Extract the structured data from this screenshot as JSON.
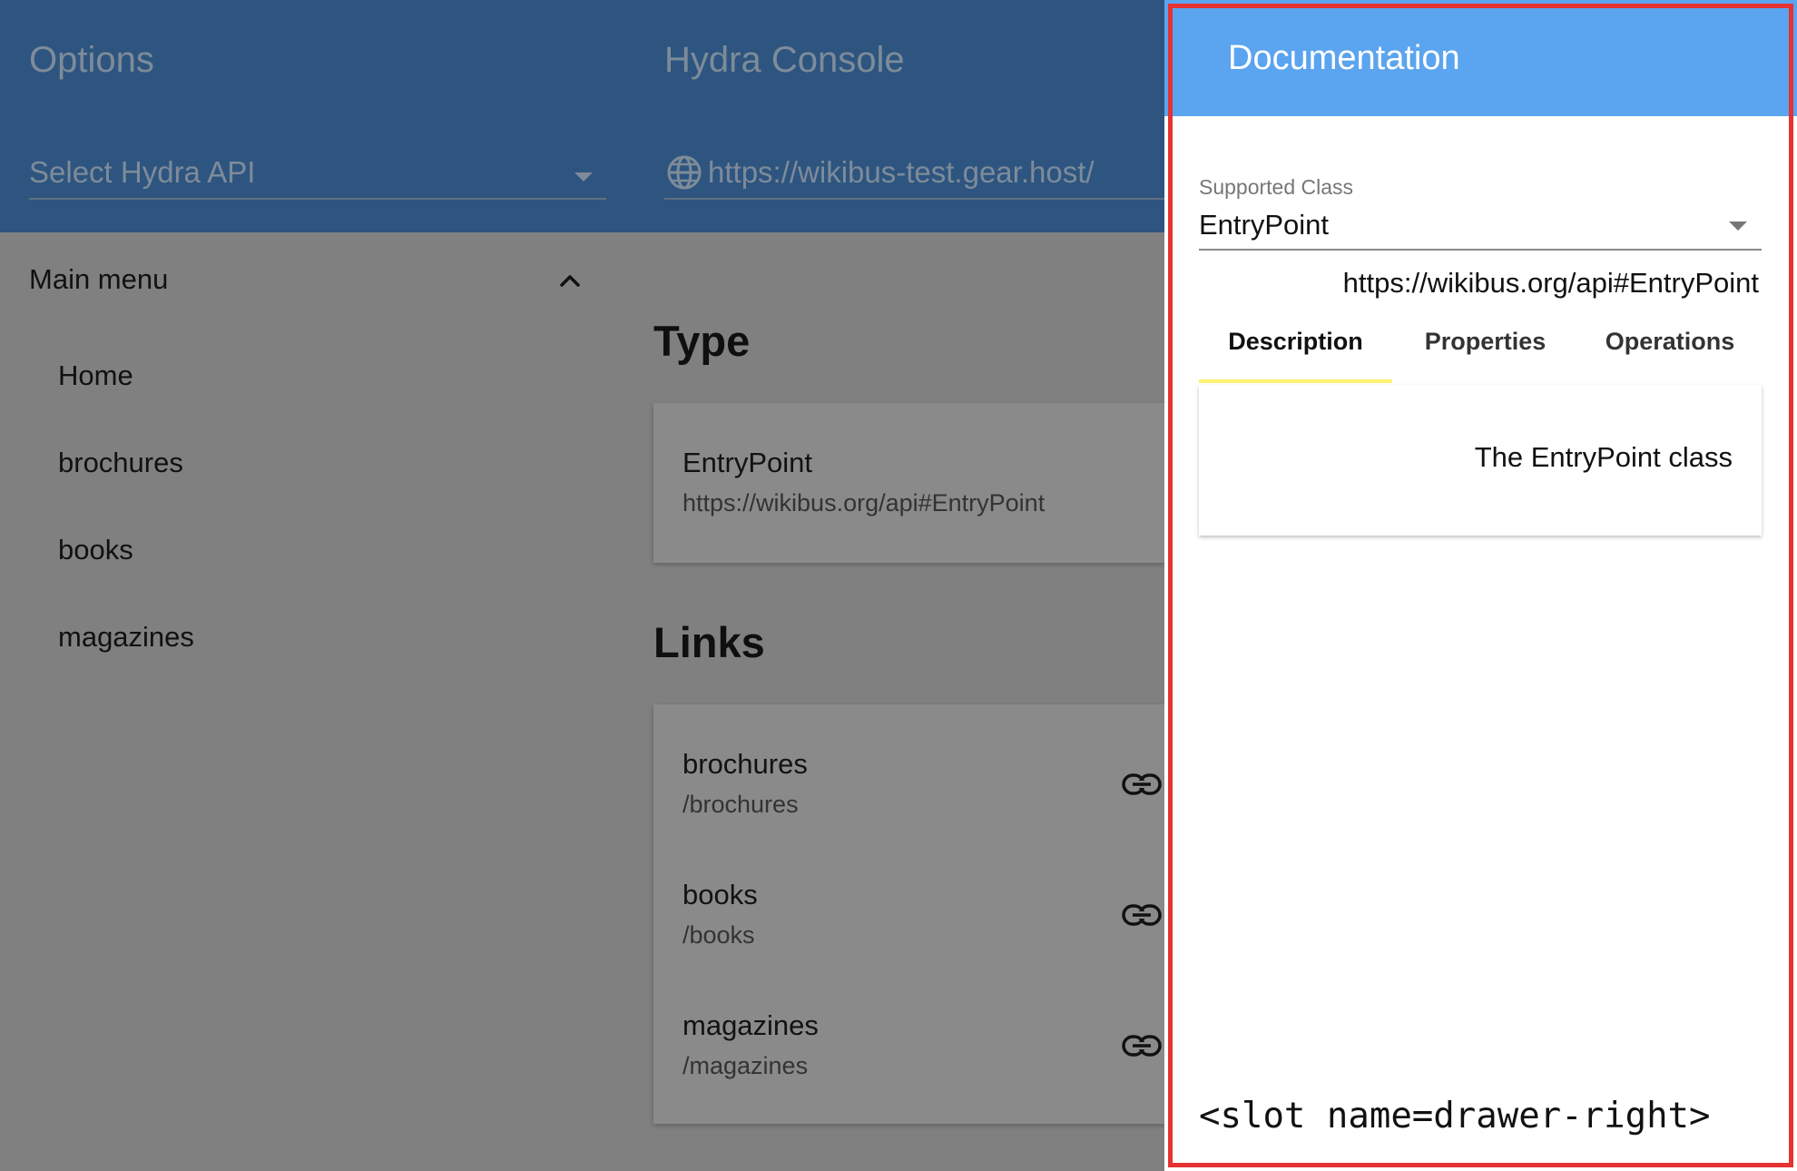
{
  "left_header": {
    "title": "Options",
    "api_select_placeholder": "Select Hydra API"
  },
  "center_header": {
    "title": "Hydra Console",
    "url": "https://wikibus-test.gear.host/"
  },
  "sidebar": {
    "header": "Main menu",
    "items": [
      {
        "label": "Home"
      },
      {
        "label": "brochures"
      },
      {
        "label": "books"
      },
      {
        "label": "magazines"
      }
    ]
  },
  "main": {
    "type_heading": "Type",
    "type_card": {
      "title": "EntryPoint",
      "iri": "https://wikibus.org/api#EntryPoint"
    },
    "links_heading": "Links",
    "links": [
      {
        "title": "brochures",
        "path": "/brochures"
      },
      {
        "title": "books",
        "path": "/books"
      },
      {
        "title": "magazines",
        "path": "/magazines"
      }
    ]
  },
  "drawer": {
    "title": "Documentation",
    "select_label": "Supported Class",
    "select_value": "EntryPoint",
    "class_iri": "https://wikibus.org/api#EntryPoint",
    "tabs": [
      {
        "label": "Description"
      },
      {
        "label": "Properties"
      },
      {
        "label": "Operations"
      }
    ],
    "description": "The EntryPoint class",
    "slot_text": "<slot name=drawer-right>"
  },
  "colors": {
    "header_bg": "#2d5580",
    "drawer_header_bg": "#5ba4ef",
    "scrim": "#808080",
    "tab_indicator": "#fff176",
    "highlight_border": "#e53232"
  },
  "icons": [
    "globe-icon",
    "chevron-up-icon",
    "dropdown-arrow-icon",
    "link-icon"
  ]
}
